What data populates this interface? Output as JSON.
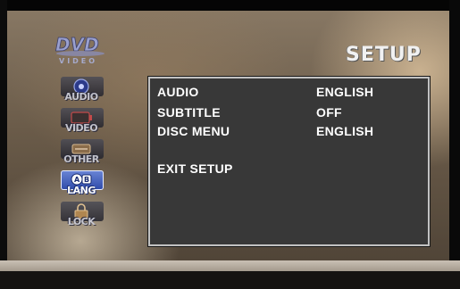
{
  "logo": {
    "brand": "DVD",
    "sub": "VIDEO"
  },
  "title": "SETUP",
  "side_menu": [
    {
      "label": "AUDIO",
      "icon": "audio-icon",
      "active": false
    },
    {
      "label": "VIDEO",
      "icon": "video-icon",
      "active": false
    },
    {
      "label": "OTHER",
      "icon": "other-icon",
      "active": false
    },
    {
      "label": "LANG",
      "icon": "language-icon",
      "active": true
    },
    {
      "label": "LOCK",
      "icon": "lock-icon",
      "active": false
    }
  ],
  "settings": [
    {
      "label": "AUDIO",
      "value": "ENGLISH"
    },
    {
      "label": "SUBTITLE",
      "value": "OFF"
    },
    {
      "label": "DISC MENU",
      "value": "ENGLISH"
    }
  ],
  "exit_label": "EXIT SETUP",
  "colors": {
    "panel_bg": "#383838",
    "panel_border": "#c2c2c2",
    "active_item": "#2d49a8",
    "text": "#ffffff"
  }
}
